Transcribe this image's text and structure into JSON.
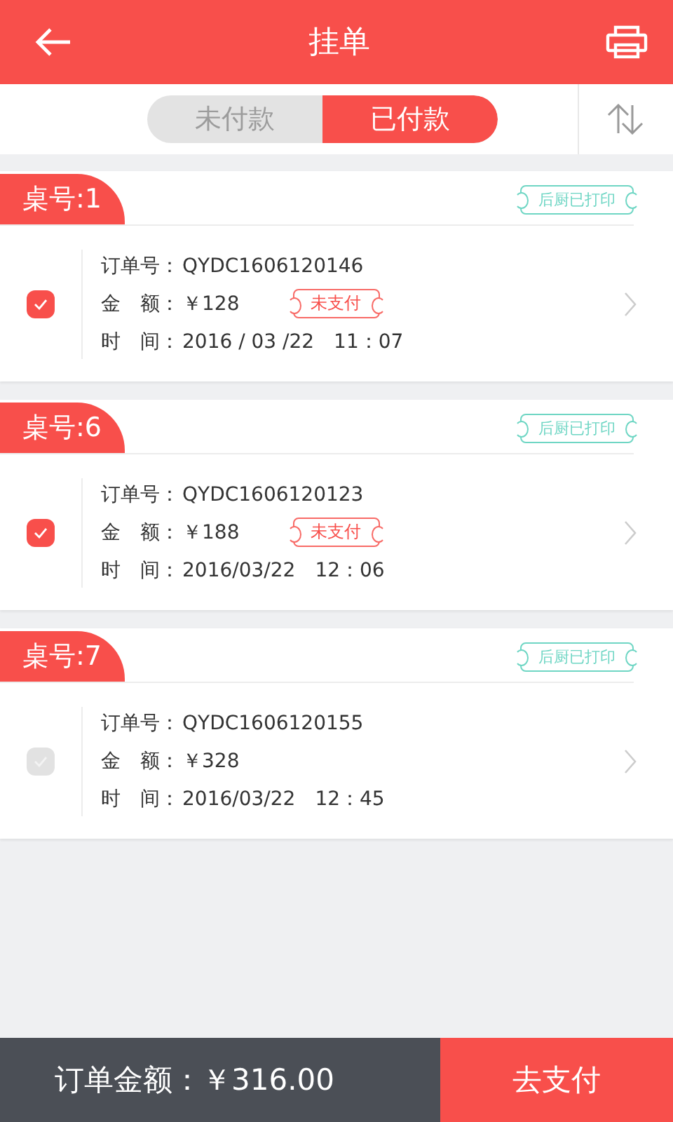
{
  "header": {
    "title": "挂单"
  },
  "tabs": [
    {
      "label": "未付款",
      "selected": false
    },
    {
      "label": "已付款",
      "selected": true
    }
  ],
  "orders": [
    {
      "table": "桌号:1",
      "kitchen_stamp": "后厨已打印",
      "checked": true,
      "fields": [
        {
          "label": "订单号：",
          "value": "QYDC1606120146"
        },
        {
          "label": "金　额：",
          "value": "￥128",
          "tag": "未支付"
        },
        {
          "label": "时　间：",
          "value": "2016 / 03 /22　11：07"
        }
      ]
    },
    {
      "table": "桌号:6",
      "kitchen_stamp": "后厨已打印",
      "checked": true,
      "fields": [
        {
          "label": "订单号：",
          "value": "QYDC1606120123"
        },
        {
          "label": "金　额：",
          "value": "￥188",
          "tag": "未支付"
        },
        {
          "label": "时　间：",
          "value": "2016/03/22　12：06"
        }
      ]
    },
    {
      "table": "桌号:7",
      "kitchen_stamp": "后厨已打印",
      "checked": false,
      "fields": [
        {
          "label": "订单号：",
          "value": "QYDC1606120155"
        },
        {
          "label": "金　额：",
          "value": "￥328"
        },
        {
          "label": "时　间：",
          "value": "2016/03/22　12：45"
        }
      ]
    }
  ],
  "footer": {
    "total_label": "订单金额：",
    "total": "￥316.00",
    "pay_button": "去支付"
  }
}
